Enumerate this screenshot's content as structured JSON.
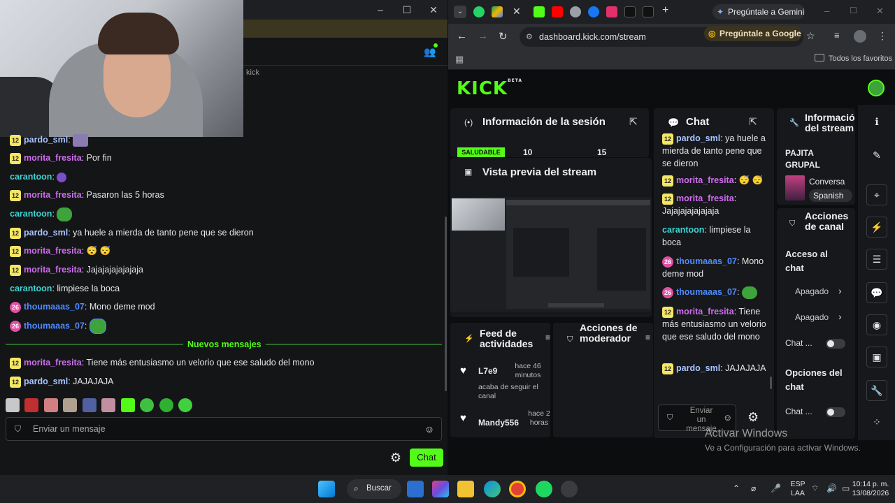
{
  "popout_chat": {
    "platform_label": "kick",
    "messages": [
      {
        "badge": "12",
        "user": "pardo_sml",
        "text": ""
      },
      {
        "badge": "12",
        "user": "morita_fresita",
        "text": "Por fin"
      },
      {
        "badge": "",
        "user": "carantoon",
        "text": ""
      },
      {
        "badge": "12",
        "user": "morita_fresita",
        "text": "Pasaron las 5 horas"
      },
      {
        "badge": "",
        "user": "carantoon",
        "text": ""
      },
      {
        "badge": "12",
        "user": "pardo_sml",
        "text": "ya huele a mierda de tanto pene que se dieron"
      },
      {
        "badge": "12",
        "user": "morita_fresita",
        "text": "😴 😴"
      },
      {
        "badge": "12",
        "user": "morita_fresita",
        "text": "Jajajajajajajaja"
      },
      {
        "badge": "",
        "user": "carantoon",
        "text": "limpiese la boca"
      },
      {
        "badge": "26",
        "user": "thoumaaas_07",
        "text": "Mono deme mod"
      },
      {
        "badge": "26",
        "user": "thoumaaas_07",
        "text": ""
      }
    ],
    "new_messages_label": "Nuevos mensajes",
    "new_messages": [
      {
        "badge": "12",
        "user": "morita_fresita",
        "text": "Tiene más entusiasmo un velorio que ese saludo del mono"
      },
      {
        "badge": "12",
        "user": "pardo_sml",
        "text": "JAJAJAJA"
      }
    ],
    "input_placeholder": "Enviar un mensaje",
    "chat_button": "Chat"
  },
  "browser": {
    "gemini_label": "Pregúntale a Gemini",
    "url": "dashboard.kick.com/stream",
    "google_label": "Pregúntale a Google",
    "bookmarks_label": "Todos los favoritos"
  },
  "dashboard": {
    "logo": "KICK",
    "logo_tag": "BETA",
    "session": {
      "title": "Información de la sesión",
      "status": "SALUDABLE",
      "stat1": "10",
      "stat2": "15"
    },
    "preview": {
      "title": "Vista previa del stream"
    },
    "feed": {
      "title": "Feed de actividades",
      "items": [
        {
          "user": "L7e9",
          "time": "hace 46 minutos",
          "action": "acaba de seguir el canal"
        },
        {
          "user": "Mandy556",
          "time": "hace 2 horas",
          "action": ""
        }
      ]
    },
    "mod_actions": {
      "title": "Acciones de moderador"
    },
    "chat": {
      "title": "Chat",
      "messages": [
        {
          "badge": "12",
          "user": "pardo_sml",
          "text": "ya huele a mierda de tanto pene que se dieron"
        },
        {
          "badge": "12",
          "user": "morita_fresita",
          "text": "😴 😴"
        },
        {
          "badge": "12",
          "user": "morita_fresita",
          "text": "Jajajajajajajaja"
        },
        {
          "badge": "",
          "user": "carantoon",
          "text": "limpiese la boca"
        },
        {
          "badge": "26",
          "user": "thoumaaas_07",
          "text": "Mono deme mod"
        },
        {
          "badge": "26",
          "user": "thoumaaas_07",
          "text": ""
        },
        {
          "badge": "12",
          "user": "morita_fresita",
          "text": "Tiene más entusiasmo un velorio que ese saludo del mono"
        },
        {
          "badge": "12",
          "user": "pardo_sml",
          "text": "JAJAJAJA"
        }
      ],
      "input_placeholder": "Enviar un mensaje"
    },
    "stream_info": {
      "title": "Información del stream",
      "stream_title": "PAJITA GRUPAL",
      "category": "Conversa",
      "language": "Spanish"
    },
    "channel_actions": {
      "title": "Acciones de canal",
      "access_label": "Acceso al chat",
      "row1": "Apagado",
      "row2": "Apagado",
      "row3": "Chat ...",
      "options_title": "Opciones del chat",
      "row4": "Chat ..."
    }
  },
  "windows": {
    "activate_title": "Activar Windows",
    "activate_sub": "Ve a Configuración para activar Windows."
  },
  "taskbar": {
    "search_label": "Buscar",
    "lang": "ESP",
    "lang_sub": "LAA",
    "time": "10:14 p. m.",
    "date": "13/08/2026"
  },
  "colors": {
    "kick_green": "#53fc18",
    "badge_yellow": "#f5e663"
  }
}
